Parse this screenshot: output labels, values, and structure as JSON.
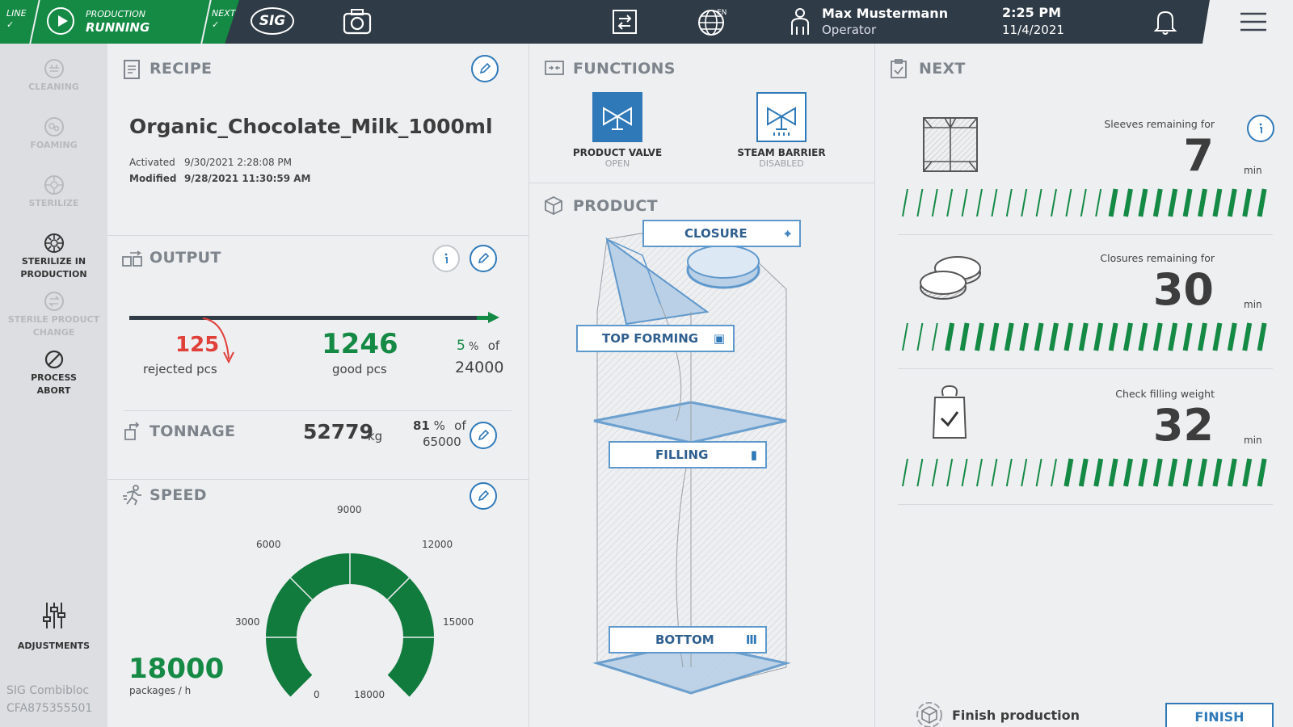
{
  "topbar": {
    "line_label": "LINE",
    "line_check": "✓",
    "production_label": "PRODUCTION",
    "production_status": "RUNNING",
    "next_label": "NEXT",
    "next_check": "✓",
    "logo": "SIG",
    "language": "EN",
    "user_name": "Max Mustermann",
    "user_role": "Operator",
    "time": "2:25 PM",
    "date": "11/4/2021",
    "icons": [
      "play-icon",
      "camera-icon",
      "swap-icon",
      "globe-icon",
      "user-icon",
      "bell-icon",
      "menu-icon"
    ]
  },
  "sidebar": {
    "items": [
      {
        "label": "CLEANING",
        "state": "disabled"
      },
      {
        "label": "FOAMING",
        "state": "disabled"
      },
      {
        "label": "STERILIZE",
        "state": "disabled"
      },
      {
        "label": "STERILIZE IN PRODUCTION",
        "state": "enabled"
      },
      {
        "label": "STERILE PRODUCT CHANGE",
        "state": "disabled"
      },
      {
        "label": "PROCESS ABORT",
        "state": "enabled"
      },
      {
        "label": "ADJUSTMENTS",
        "state": "enabled"
      }
    ],
    "footer_line1": "SIG Combibloc",
    "footer_line2": "CFA875355501"
  },
  "recipe": {
    "title": "RECIPE",
    "name": "Organic_Chocolate_Milk_1000ml",
    "activated_label": "Activated",
    "activated_value": "9/30/2021 2:28:08 PM",
    "modified_label": "Modified",
    "modified_value": "9/28/2021 11:30:59 AM"
  },
  "output": {
    "title": "OUTPUT",
    "rejected_value": "125",
    "rejected_label": "rejected pcs",
    "good_value": "1246",
    "good_label": "good pcs",
    "percent_value": "5",
    "percent_unit": "%",
    "of_label": "of",
    "target": "24000",
    "progress": 0.05
  },
  "tonnage": {
    "title": "TONNAGE",
    "value": "52779",
    "unit": "kg",
    "percent_value": "81",
    "percent_unit": "%",
    "of_label": "of",
    "target": "65000"
  },
  "speed": {
    "title": "SPEED",
    "value": "18000",
    "unit": "packages / h",
    "gauge_ticks": [
      "0",
      "3000",
      "6000",
      "9000",
      "12000",
      "15000",
      "18000"
    ],
    "gauge_max": 18000,
    "gauge_value": 18000
  },
  "functions": {
    "title": "FUNCTIONS",
    "items": [
      {
        "label": "PRODUCT VALVE",
        "status": "OPEN"
      },
      {
        "label": "STEAM BARRIER",
        "status": "DISABLED"
      }
    ]
  },
  "product": {
    "title": "PRODUCT",
    "stations": [
      "CLOSURE",
      "TOP FORMING",
      "FILLING",
      "BOTTOM"
    ]
  },
  "next": {
    "title": "NEXT",
    "items": [
      {
        "label": "Sleeves remaining for",
        "value": "7",
        "unit": "min",
        "fill_fraction": 0.45
      },
      {
        "label": "Closures remaining for",
        "value": "30",
        "unit": "min",
        "fill_fraction": 0.87
      },
      {
        "label": "Check filling weight",
        "value": "32",
        "unit": "min",
        "fill_fraction": 0.55
      }
    ],
    "finish_label": "Finish production",
    "finish_button": "FINISH"
  },
  "colors": {
    "green": "#148a45",
    "dark_bar": "#2f3b46",
    "accent_blue": "#2f79b9",
    "reject_red": "#e0403a",
    "stripe_light": "#148a45",
    "gauge_green": "#117a3d"
  }
}
